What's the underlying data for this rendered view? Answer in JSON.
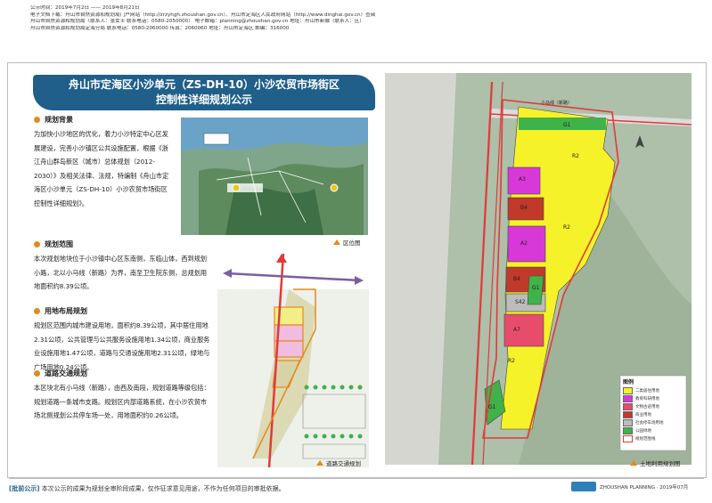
{
  "header": {
    "lines": [
      "公示时间：2019年7月2日 —— 2019年8月21日",
      "电子文档下载：舟山市自然资源和规划局门户网站（http://zrzyhgh.zhoushan.gov.cn）、舟山市定海区人民政府网站（http://www.dinghai.gov.cn）查阅",
      "舟山市自然资源和规划局（联系人：张女士  联系电话：0580-2050000）  电子邮箱：planning@zhoushan.gov.cn  地址：舟山市新城（联系人：区）",
      "舟山市自然资源和规划局定海分局  联系电话：0580-2060000  传真：2060060  地址：舟山市定海区 邮编：316000"
    ]
  },
  "title": {
    "line1": "舟山市定海区小沙单元（ZS-DH-10）小沙农贸市场街区",
    "line2": "控制性详细规划公示"
  },
  "sections": [
    {
      "title": "规划背景",
      "body": "为加快小沙地区的优化，着力小沙特定中心区发展建设，完善小沙镇区公共设施配置，根据《浙江舟山群岛新区（城市）总体规划（2012-2030）》及相关法律、法规，特编制《舟山市定海区小沙单元（ZS-DH-10）小沙农贸市场街区控制性详细规划》。"
    },
    {
      "title": "规划范围",
      "body": "本次规划地块位于小沙镇中心区东南侧，东临山体，西到规划小路，北以小马线（新路）为界，南至卫生院东侧，总规划用地面积约8.39公顷。"
    },
    {
      "title": "用地布局规划",
      "body": "规划区范围内城市建设用地，面积约8.39公顷，其中居住用地2.31公顷，公共管理与公共服务设施用地1.34公顷，商业服务业设施用地1.47公顷，道路与交通设施用地2.31公顷，绿地与广场用地0.24公顷。"
    },
    {
      "title": "道路交通规划",
      "body": "本区块北有小马线（新路），由西及南段，规划道路等级包括：规划道路一条城市支路。规划区内部道路系统，在小沙农贸市场北侧规划公共停车场一处，用地面积约0.26公顷。"
    }
  ],
  "captions": {
    "location": "区位图",
    "traffic": "道路交通规划",
    "landuse": "土地利用规划图"
  },
  "map_labels": {
    "road_top": "小马线（新路）",
    "parcels": [
      "G1",
      "R2",
      "A3",
      "B4",
      "A2",
      "B4",
      "S42",
      "G1",
      "R2",
      "A7",
      "R2",
      "G1"
    ]
  },
  "legend": {
    "title": "图例",
    "items": [
      {
        "code": "R2",
        "label": "二类居住用地",
        "color": "#f5f22a"
      },
      {
        "code": "A3",
        "label": "教育科研用地",
        "color": "#d938d9"
      },
      {
        "code": "A7",
        "label": "文物古迹用地",
        "color": "#e84c6b"
      },
      {
        "code": "B4",
        "label": "商业用地",
        "color": "#c0392b"
      },
      {
        "code": "S42",
        "label": "社会停车场用地",
        "color": "#bcbcbc"
      },
      {
        "code": "G1",
        "label": "公园绿地",
        "color": "#3fb24a"
      },
      {
        "code": "",
        "label": "规划范围线",
        "color": "#e03a3a"
      }
    ]
  },
  "footer": {
    "tag": "[批前公示]",
    "note": "本次公示的成果为规划全审阶段成果，仅作征求意见用途，不作为任何项目的审批依据。",
    "brand": "ZHOUSHAN PLANNING · 2019年07月"
  },
  "colors": {
    "banner": "#1f5f8a",
    "accent": "#e48a1b",
    "residential": "#f5f22a",
    "education": "#d938d9",
    "commercial": "#c0392b",
    "green": "#3fb24a"
  }
}
